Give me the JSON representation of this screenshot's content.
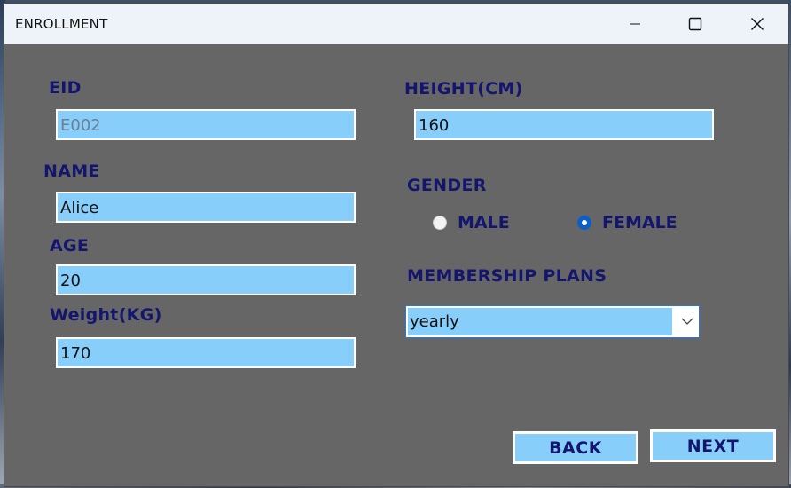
{
  "window": {
    "title": "ENROLLMENT",
    "controls": {
      "minimize": "minimize-icon",
      "maximize": "maximize-icon",
      "close": "close-icon"
    }
  },
  "form": {
    "eid": {
      "label": "EID",
      "value": "E002"
    },
    "name": {
      "label": "NAME",
      "value": "Alice"
    },
    "age": {
      "label": "AGE",
      "value": "20"
    },
    "weight": {
      "label": "Weight(KG)",
      "value": "170"
    },
    "height": {
      "label": "HEIGHT(CM)",
      "value": "160"
    },
    "gender": {
      "label": "GENDER",
      "options": [
        {
          "label": "MALE",
          "selected": false
        },
        {
          "label": "FEMALE",
          "selected": true
        }
      ]
    },
    "membership": {
      "label": "MEMBERSHIP PLANS",
      "selected": "yearly"
    }
  },
  "buttons": {
    "back": "BACK",
    "next": "NEXT"
  },
  "colors": {
    "panel": "#666666",
    "field": "#87cefa",
    "label": "#14166e",
    "radio_selected": "#0b5fc8"
  }
}
